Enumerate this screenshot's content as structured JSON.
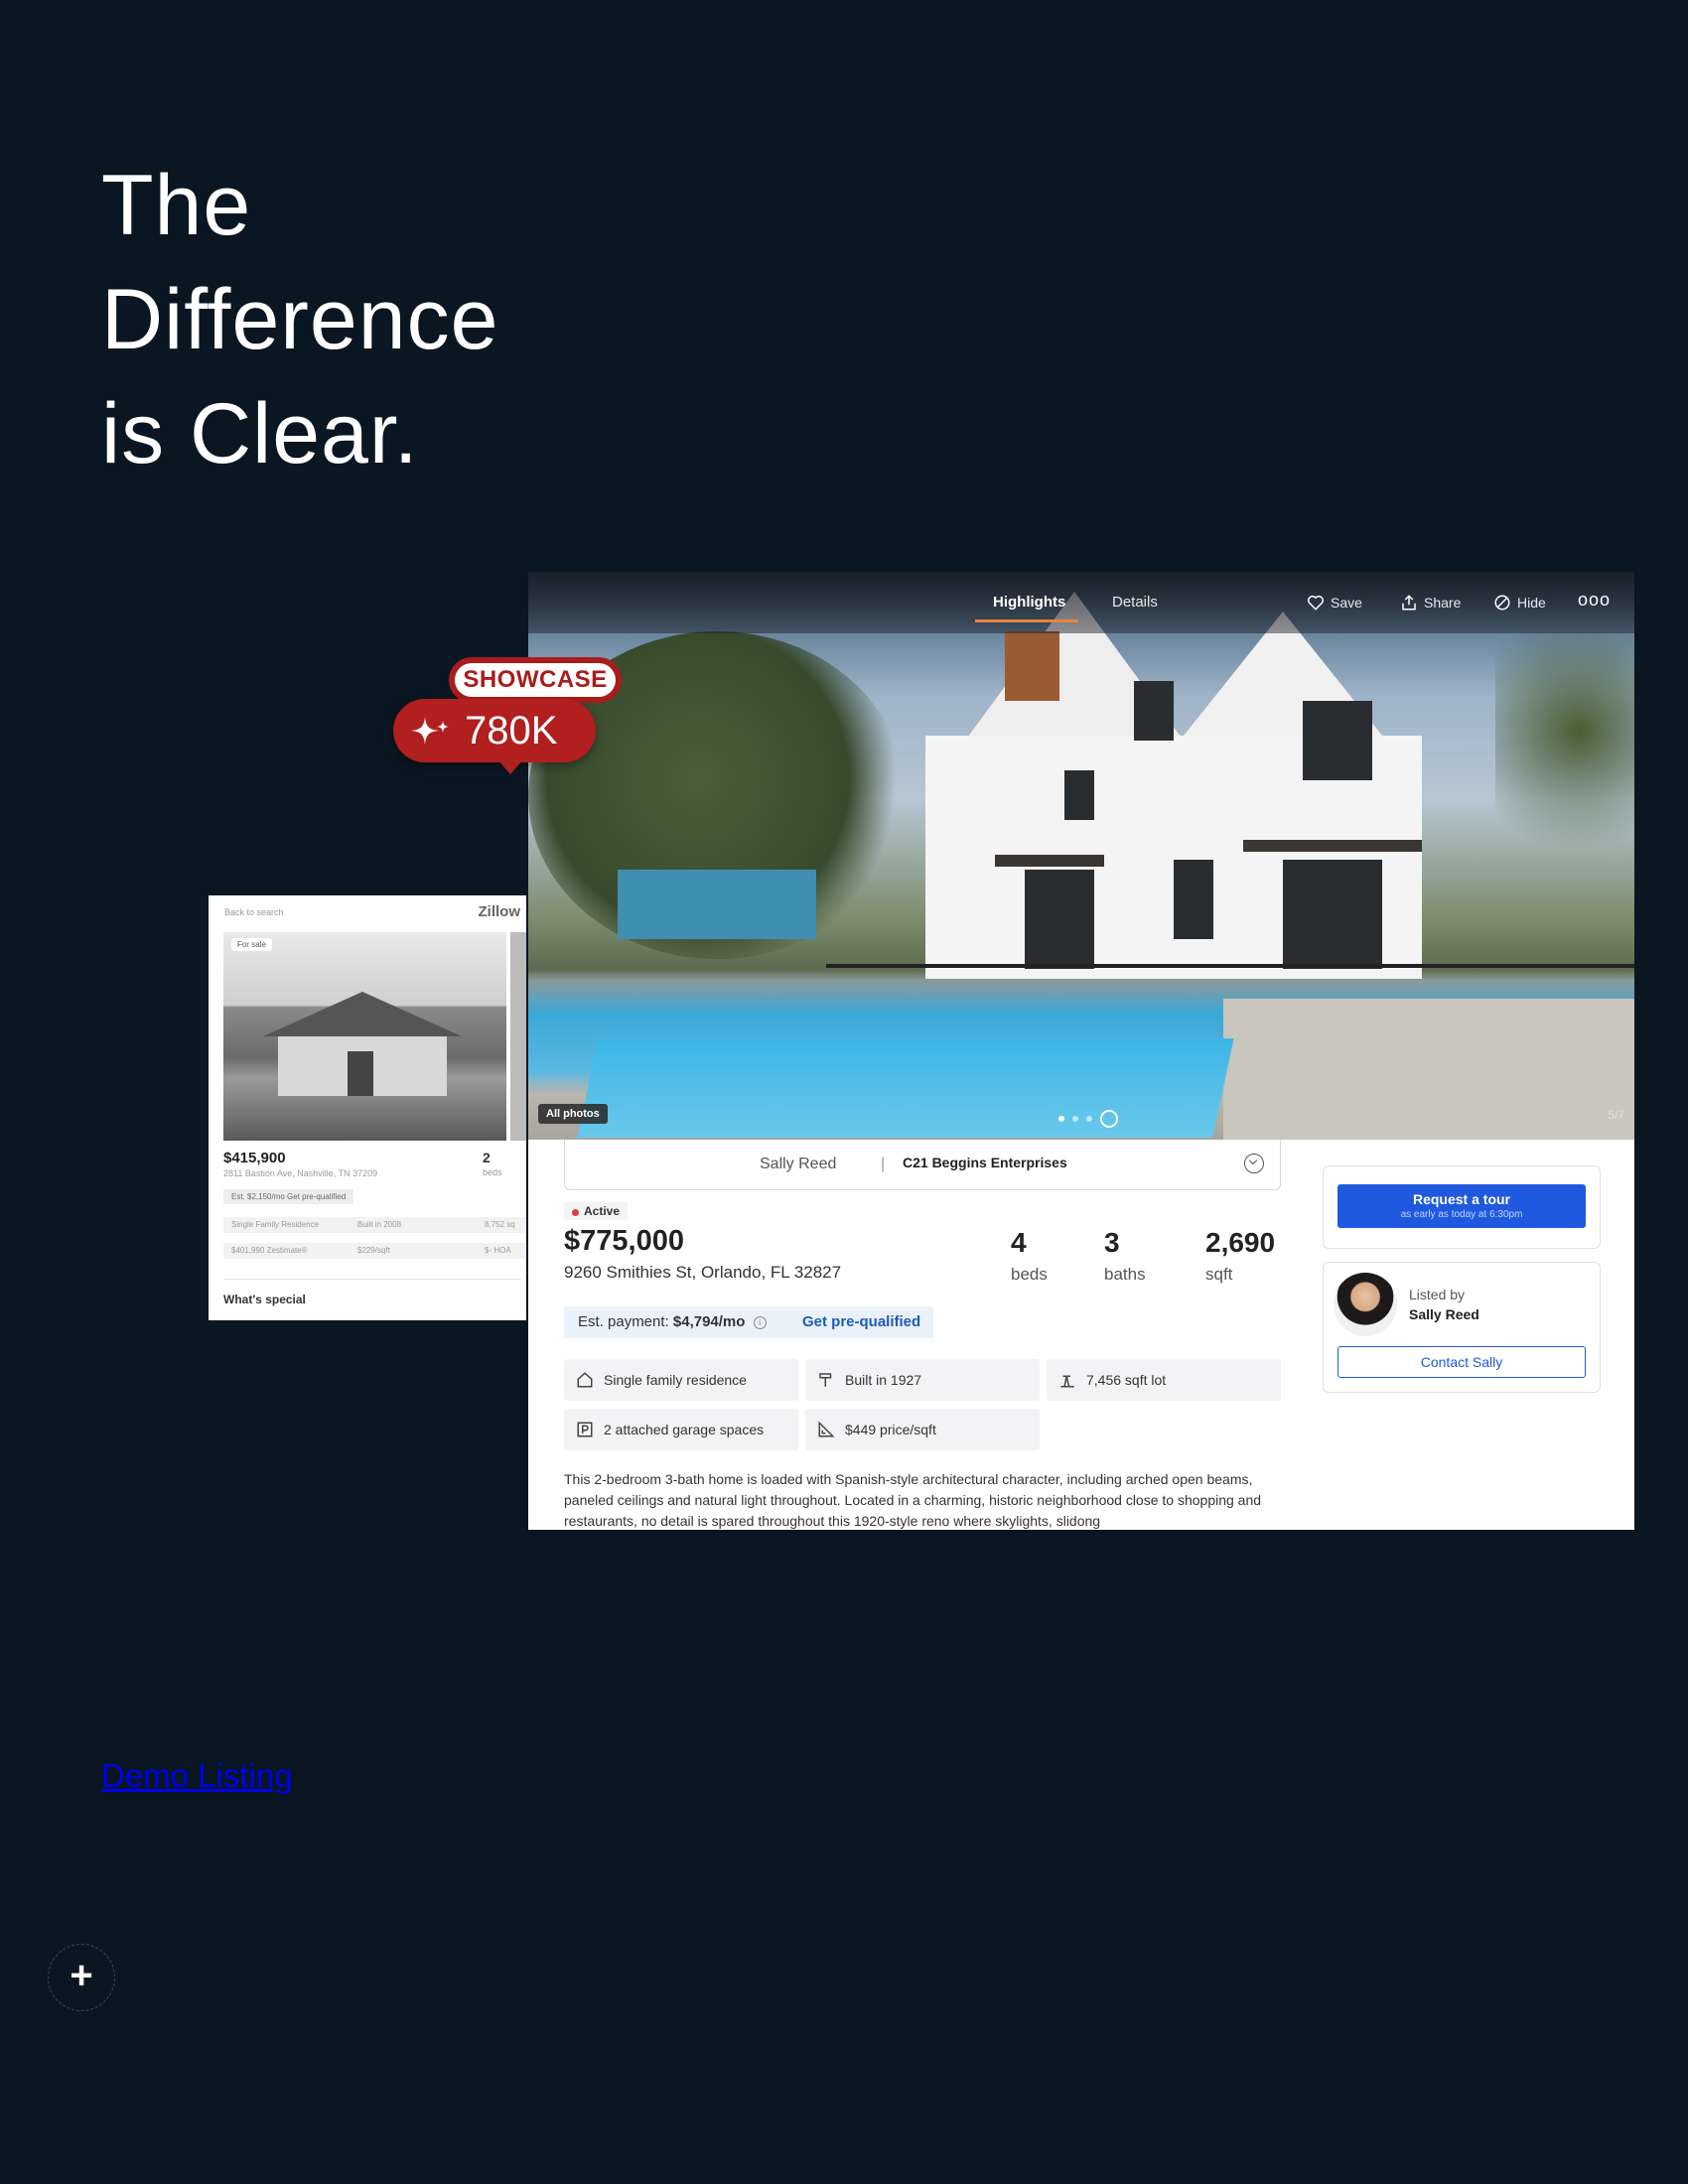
{
  "headline": {
    "line1": "The",
    "line2": "Difference",
    "line3": "is Clear."
  },
  "back_card": {
    "back_label": "Back to search",
    "brand": "Zillow",
    "badge": "For sale",
    "price": "$415,900",
    "address": "2811 Bastion Ave, Nashville, TN 37209",
    "beds_value": "2",
    "beds_label": "beds",
    "est_text": "Est. $2,150/mo  Get pre-qualified",
    "chips": [
      "Single Family Residence",
      "Built in 2008",
      "8,752 sq",
      "$401,990 Zestimate®",
      "$229/sqft",
      "$- HOA"
    ],
    "section_title": "What's special"
  },
  "listing": {
    "tabs": {
      "highlights": "Highlights",
      "details": "Details"
    },
    "actions": {
      "save": "Save",
      "share": "Share",
      "hide": "Hide",
      "more": "ooo"
    },
    "all_photos": "All photos",
    "photo_count": "5/7",
    "agent_name": "Sally Reed",
    "agent_separator": "|",
    "brokerage": "C21 Beggins Enterprises",
    "status": "Active",
    "price": "$775,000",
    "address": "9260 Smithies St, Orlando, FL 32827",
    "stats": [
      {
        "value": "4",
        "label": "beds"
      },
      {
        "value": "3",
        "label": "baths"
      },
      {
        "value": "2,690",
        "label": "sqft"
      }
    ],
    "est_payment_label": "Est. payment:",
    "est_payment_value": "$4,794/mo",
    "est_info": "i",
    "prequal_link": "Get pre-qualified",
    "facts": [
      {
        "icon": "home-icon",
        "text": "Single family residence"
      },
      {
        "icon": "hammer-icon",
        "text": "Built in 1927"
      },
      {
        "icon": "lot-icon",
        "text": "7,456 sqft lot"
      },
      {
        "icon": "parking-icon",
        "text": "2 attached garage spaces"
      },
      {
        "icon": "ruler-icon",
        "text": "$449 price/sqft"
      }
    ],
    "description": "This 2-bedroom 3-bath home is loaded with Spanish-style architectural character, including arched open beams, paneled ceilings and natural light throughout. Located in a charming, historic neighborhood close to shopping and restaurants, no detail is spared throughout this 1920-style reno where skylights, slidong",
    "tour_button": {
      "label": "Request a tour",
      "sub": "as early as today at 6:30pm"
    },
    "listed_by_label": "Listed by",
    "listed_by_name": "Sally Reed",
    "contact_button": "Contact Sally"
  },
  "showcase": {
    "label": "SHOWCASE",
    "value": "780K"
  },
  "demo_link": "Demo Listing",
  "plus_button": "+",
  "colors": {
    "background": "#0a1621",
    "brand_red": "#b11f1f",
    "cta_blue": "#1f59e0",
    "tab_accent": "#e8843a"
  }
}
